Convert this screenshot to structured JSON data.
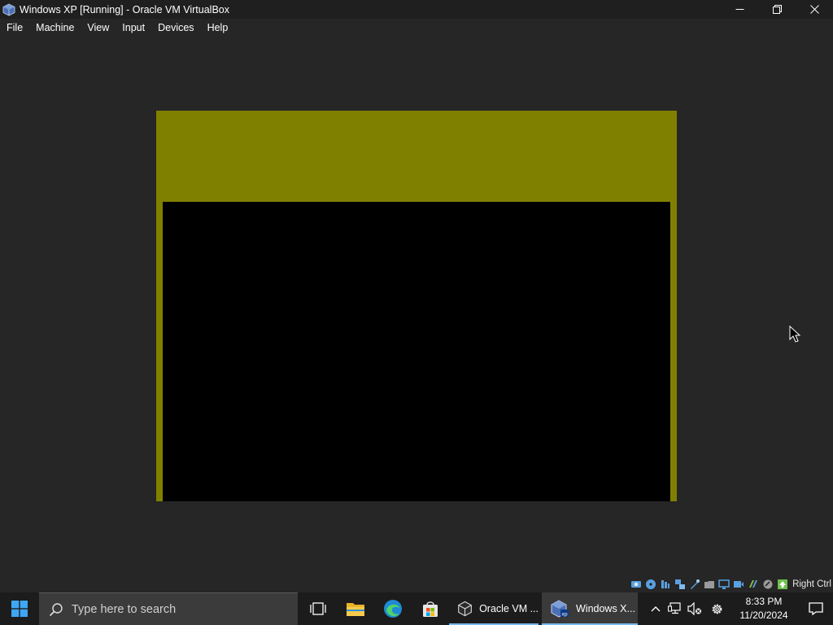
{
  "window": {
    "title": "Windows XP [Running] - Oracle VM VirtualBox",
    "app_icon": "virtualbox-icon"
  },
  "menu": [
    "File",
    "Machine",
    "View",
    "Input",
    "Devices",
    "Help"
  ],
  "vm_display": {
    "background_color": "#808000",
    "inner_color": "#000000"
  },
  "status_bar": {
    "icons": [
      "hard-disk-icon",
      "optical-drive-icon",
      "audio-icon",
      "network-icon",
      "usb-icon",
      "shared-folder-icon",
      "display-icon",
      "video-capture-icon",
      "cpu-icon",
      "mouse-integration-icon",
      "keyboard-icon"
    ],
    "host_key": "Right Ctrl"
  },
  "taskbar": {
    "search_placeholder": "Type here to search",
    "pinned": [
      "task-view-icon",
      "file-explorer-icon",
      "edge-icon",
      "store-icon"
    ],
    "apps": [
      {
        "label": "Oracle VM ...",
        "icon": "virtualbox-icon",
        "active": false
      },
      {
        "label": "Windows X...",
        "icon": "windows-xp-vm-icon",
        "active": true
      }
    ],
    "tray_icons": [
      "chevron-up-icon",
      "network-icon",
      "volume-muted-icon",
      "settings-icon"
    ],
    "time": "8:33 PM",
    "date": "11/20/2024"
  }
}
